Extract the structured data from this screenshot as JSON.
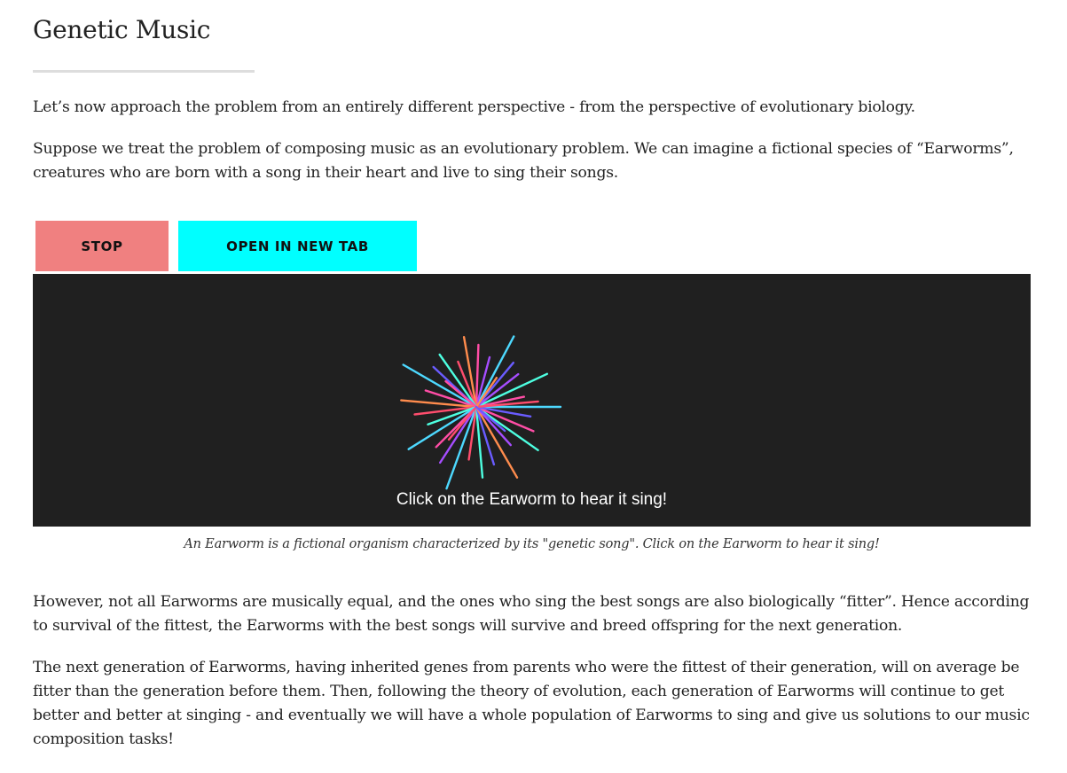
{
  "article": {
    "title": "Genetic Music",
    "paragraphs": [
      "Let’s now approach the problem from an entirely different perspective - from the perspective of evolutionary biology.",
      "Suppose we treat the problem of composing music as an evolutionary problem. We can imagine a fictional species of “Earworms”, creatures who are born with a song in their heart and live to sing their songs.",
      "However, not all Earworms are musically equal, and the ones who sing the best songs are also biologically “fitter”. Hence according to survival of the fittest, the Earworms with the best songs will survive and breed offspring for the next generation.",
      "The next generation of Earworms, having inherited genes from parents who were the fittest of their generation, will on average be fitter than the generation before them. Then, following the theory of evolution, each generation of Earworms will continue to get better and better at singing - and eventually we will have a whole population of Earworms to sing and give us solutions to our music composition tasks!"
    ]
  },
  "controls": {
    "stop_label": "STOP",
    "open_label": "OPEN IN NEW TAB",
    "stop_color": "#f08080",
    "open_color": "#00ffff"
  },
  "demo": {
    "background": "#202020",
    "hint": "Click on the Earworm to hear it sing!",
    "caption": "An Earworm is a fictional organism characterized by its \"genetic song\". Click on the Earworm to hear it sing!",
    "palette": [
      "#4dd9ff",
      "#ff4d6d",
      "#a64dff",
      "#4dffe1",
      "#ff8c4d",
      "#6a5cff",
      "#ff4da6"
    ]
  }
}
